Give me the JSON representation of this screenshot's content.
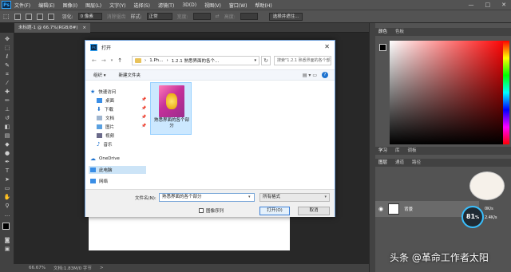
{
  "app": {
    "logo_text": "Ps",
    "menu": [
      "文件(F)",
      "编辑(E)",
      "图像(I)",
      "图层(L)",
      "文字(Y)",
      "选择(S)",
      "滤镜(T)",
      "3D(D)",
      "视图(V)",
      "窗口(W)",
      "帮助(H)"
    ],
    "window_controls": [
      "—",
      "□",
      "✕"
    ]
  },
  "options": {
    "feather_label": "羽化:",
    "feather_value": "0 像素",
    "antialias_label": "消除锯齿",
    "style_label": "样式:",
    "style_value": "正常",
    "width_label": "宽度:",
    "height_label": "高度:",
    "select_mask_button": "选择并遮住..."
  },
  "document": {
    "tab_title": "未标题-1 @ 66.7%(RGB/8#)",
    "tab_close": "×"
  },
  "status": {
    "zoom": "66.67%",
    "doc_info": "文档:1.83M/0 字节",
    "arrow": ">"
  },
  "panels": {
    "color_tabs": [
      "颜色",
      "色板"
    ],
    "learn_tabs": [
      "学习",
      "库",
      "调板"
    ],
    "layers_tabs": [
      "图层",
      "通道",
      "路径"
    ],
    "layer_name": "背景"
  },
  "overlay": {
    "gauge_value": "81",
    "gauge_unit": "%",
    "upload_speed": "0K/s",
    "download_speed": "2.4K/s",
    "watermark": "头条 @革命工作者太阳"
  },
  "dialog": {
    "title": "打开",
    "close": "✕",
    "path_parts": [
      "1.Ph...",
      "1.2.1 熟悉界面的各个...",
      ""
    ],
    "search_placeholder": "搜索\"1.2.1 熟悉界面的各个部分\"",
    "organize_label": "组织 ▾",
    "new_folder_label": "新建文件夹",
    "nav_items": [
      {
        "label": "快速访问",
        "icon": "star-icon"
      },
      {
        "label": "桌面",
        "icon": "desktop-icon"
      },
      {
        "label": "下载",
        "icon": "download-icon"
      },
      {
        "label": "文档",
        "icon": "document-icon"
      },
      {
        "label": "图片",
        "icon": "pictures-icon"
      },
      {
        "label": "视频",
        "icon": "video-icon"
      },
      {
        "label": "音乐",
        "icon": "music-icon"
      },
      {
        "label": "OneDrive",
        "icon": "cloud-icon"
      },
      {
        "label": "此电脑",
        "icon": "computer-icon"
      },
      {
        "label": "网络",
        "icon": "network-icon"
      }
    ],
    "file_name_display": "熟悉界面的各个部分",
    "filename_label": "文件名(N):",
    "filename_value": "熟悉界面的各个部分",
    "filetype_value": "所有格式",
    "sequence_label": "图像序列",
    "open_button": "打开(O)",
    "cancel_button": "取消"
  }
}
